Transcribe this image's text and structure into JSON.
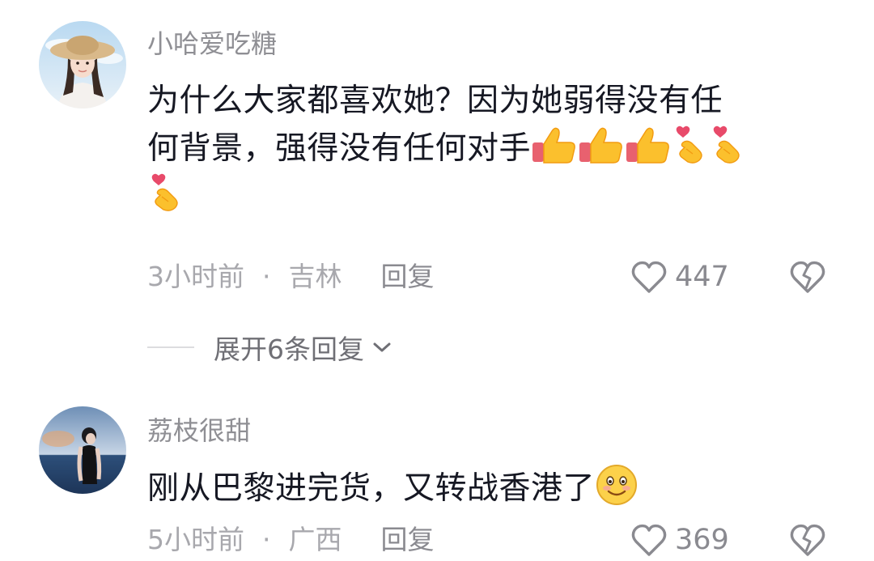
{
  "comments": [
    {
      "username": "小哈爱吃糖",
      "text_line1": "为什么大家都喜欢她？因为她弱得没有任",
      "text_line2": "何背景，强得没有任何对手",
      "emojis": [
        "thumbs-up",
        "thumbs-up",
        "thumbs-up",
        "finger-heart",
        "finger-heart",
        "finger-heart"
      ],
      "time": "3小时前",
      "separator": "·",
      "location": "吉林",
      "reply_label": "回复",
      "like_count": "447",
      "expand_label": "展开6条回复"
    },
    {
      "username": "荔枝很甜",
      "text": "刚从巴黎进完货，又转战香港了",
      "emojis": [
        "smile"
      ],
      "time": "5小时前",
      "separator": "·",
      "location": "广西",
      "reply_label": "回复",
      "like_count": "369"
    }
  ],
  "colors": {
    "username": "#8f8f94",
    "content": "#161823",
    "meta": "#a8a8ad",
    "action": "#8a8a90"
  }
}
